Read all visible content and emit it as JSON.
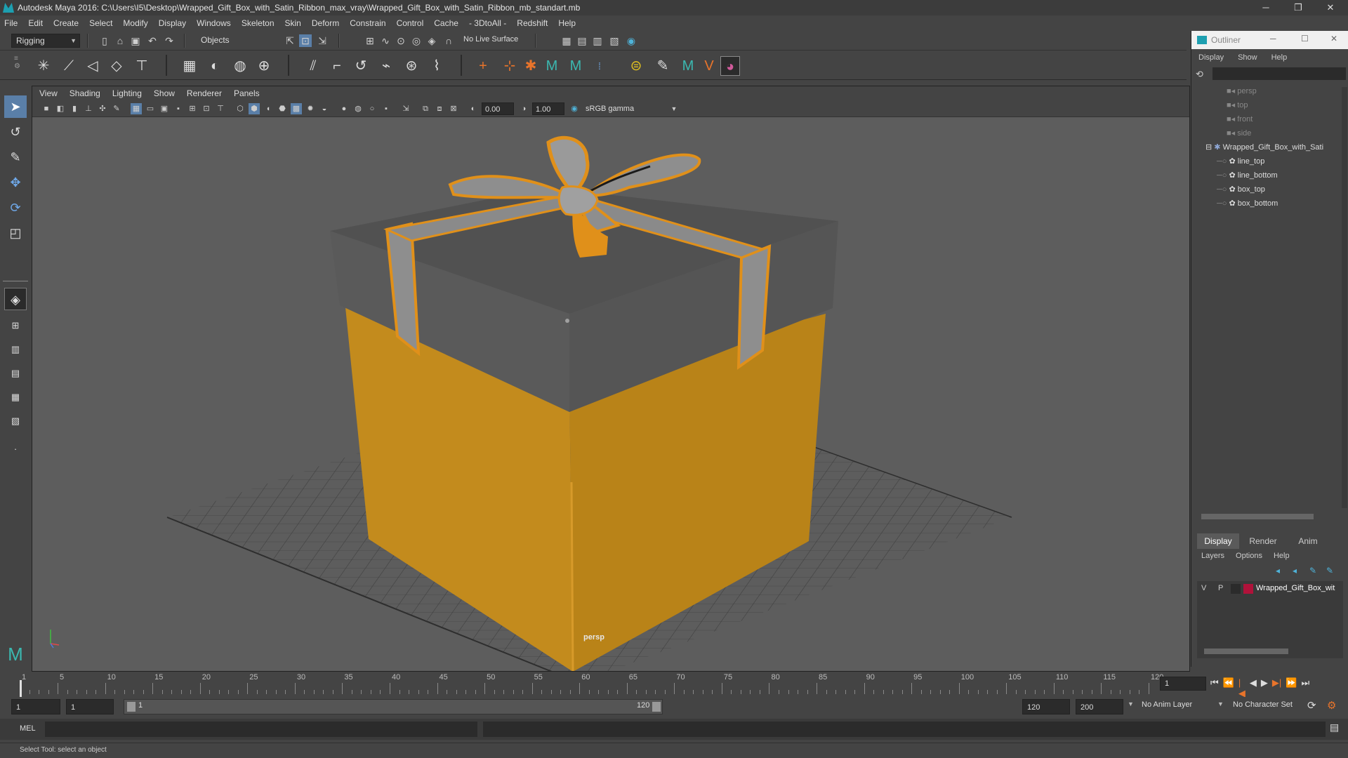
{
  "window": {
    "title": "Autodesk Maya 2016: C:\\Users\\I5\\Desktop\\Wrapped_Gift_Box_with_Satin_Ribbon_max_vray\\Wrapped_Gift_Box_with_Satin_Ribbon_mb_standart.mb",
    "minimize": "─",
    "restore": "❐",
    "close": "✕"
  },
  "menu": [
    "File",
    "Edit",
    "Create",
    "Select",
    "Modify",
    "Display",
    "Windows",
    "Skeleton",
    "Skin",
    "Deform",
    "Constrain",
    "Control",
    "Cache",
    "- 3DtoAll -",
    "Redshift",
    "Help"
  ],
  "status_line": {
    "menuset": "Rigging",
    "select_mode": "Objects",
    "live_surface": "No Live Surface"
  },
  "viewport": {
    "menu": [
      "View",
      "Shading",
      "Lighting",
      "Show",
      "Renderer",
      "Panels"
    ],
    "exposure": "0.00",
    "gamma": "1.00",
    "colorspace": "sRGB gamma",
    "camera_label": "persp",
    "colors": {
      "box_bottom": "#c98f1e",
      "box_top": "#5a5a5a",
      "ribbon": "#8e8e8e",
      "ribbon_edge": "#e0901a",
      "background": "#5d5d5d"
    }
  },
  "outliner": {
    "title": "Outliner",
    "menu": [
      "Display",
      "Show",
      "Help"
    ],
    "cameras": [
      "persp",
      "top",
      "front",
      "side"
    ],
    "group": "Wrapped_Gift_Box_with_Sati",
    "children": [
      "line_top",
      "line_bottom",
      "box_top",
      "box_bottom"
    ]
  },
  "layer_editor": {
    "tabs": [
      "Display",
      "Render",
      "Anim"
    ],
    "menu": [
      "Layers",
      "Options",
      "Help"
    ],
    "layer": {
      "v": "V",
      "p": "P",
      "name": "Wrapped_Gift_Box_wit",
      "color": "#b0123a"
    }
  },
  "timeline": {
    "ticks": [
      "1",
      "5",
      "10",
      "15",
      "20",
      "25",
      "30",
      "35",
      "40",
      "45",
      "50",
      "55",
      "60",
      "65",
      "70",
      "75",
      "80",
      "85",
      "90",
      "95",
      "100",
      "105",
      "110",
      "115",
      "120"
    ],
    "current_frame": "1",
    "playback": [
      "⏮",
      "⏪",
      "|◀",
      "◀",
      "▶",
      "▶|",
      "⏩",
      "⏭"
    ]
  },
  "range": {
    "start": "1",
    "playback_start": "1",
    "slider_start": "1",
    "slider_end": "120",
    "playback_end": "120",
    "end": "200",
    "anim_layer": "No Anim Layer",
    "character_set": "No Character Set"
  },
  "command_line": {
    "label": "MEL"
  },
  "help_line": "Select Tool: select an object"
}
